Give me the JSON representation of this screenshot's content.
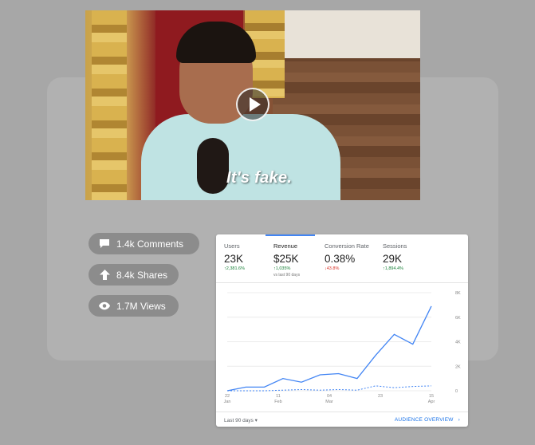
{
  "video": {
    "caption": "It's fake."
  },
  "stats": {
    "comments": "1.4k Comments",
    "shares": "8.4k Shares",
    "views": "1.7M Views"
  },
  "analytics": {
    "tabs": [
      {
        "label": "Users",
        "value": "23K",
        "delta": "↑2,381.6%",
        "trend": "up"
      },
      {
        "label": "Revenue",
        "value": "$25K",
        "delta": "↑1,035%",
        "trend": "up",
        "sub": "vs last 90 days"
      },
      {
        "label": "Conversion Rate",
        "value": "0.38%",
        "delta": "↓43.8%",
        "trend": "down"
      },
      {
        "label": "Sessions",
        "value": "29K",
        "delta": "↑1,894.4%",
        "trend": "up"
      }
    ],
    "footer": {
      "range": "Last 90 days ▾",
      "link": "AUDIENCE OVERVIEW"
    }
  },
  "chart_data": {
    "type": "line",
    "x": [
      "22 Jan",
      "",
      "11 Feb",
      "",
      "",
      "04 Mar",
      "",
      "",
      "23",
      "",
      "15 Apr"
    ],
    "x_ticks": [
      {
        "label": "22",
        "sub": "Jan",
        "i": 0
      },
      {
        "label": "11",
        "sub": "Feb",
        "i": 2.5
      },
      {
        "label": "04",
        "sub": "Mar",
        "i": 5
      },
      {
        "label": "23",
        "sub": "",
        "i": 7.5
      },
      {
        "label": "15",
        "sub": "Apr",
        "i": 10
      }
    ],
    "series": [
      {
        "values": [
          0,
          300,
          300,
          1000,
          700,
          1300,
          1400,
          1000,
          2900,
          4600,
          3800,
          6900
        ],
        "color": "#4285f4",
        "style": "solid"
      },
      {
        "values": [
          0,
          0,
          0,
          50,
          100,
          50,
          100,
          50,
          400,
          250,
          350,
          400
        ],
        "color": "#4285f4",
        "style": "dashed"
      }
    ],
    "yticks": [
      "0",
      "2K",
      "4K",
      "6K",
      "8K"
    ],
    "ylim": [
      0,
      8000
    ],
    "grid": true
  }
}
